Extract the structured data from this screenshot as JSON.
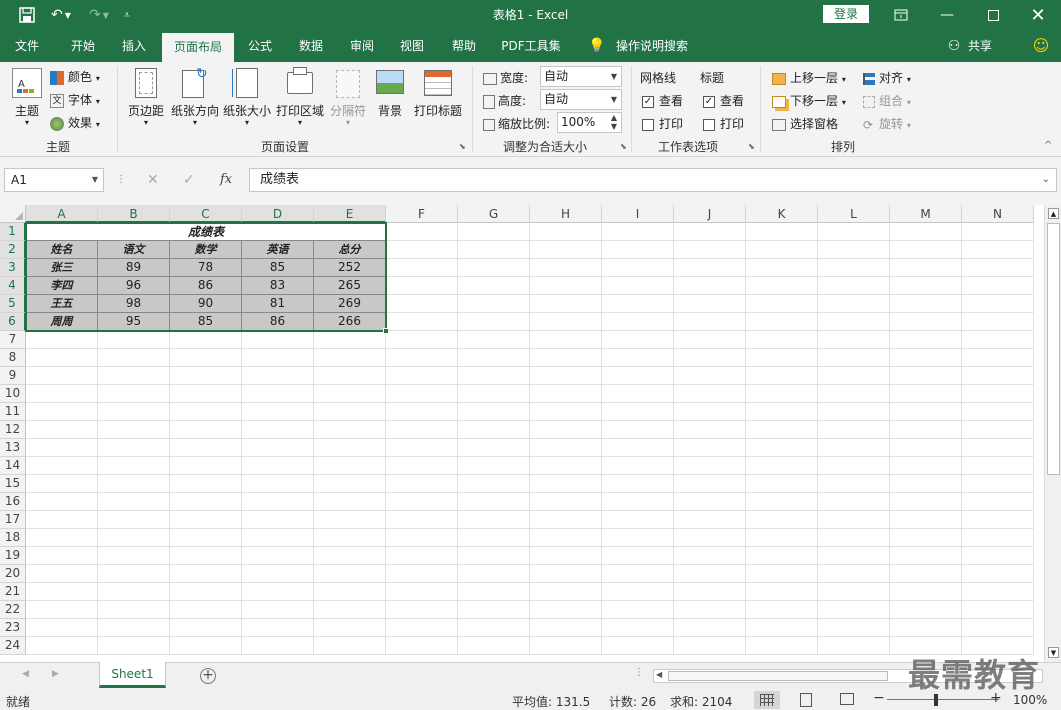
{
  "window": {
    "title": "表格1  -  Excel",
    "login": "登录"
  },
  "tabs": [
    "文件",
    "开始",
    "插入",
    "页面布局",
    "公式",
    "数据",
    "审阅",
    "视图",
    "帮助",
    "PDF工具集",
    "操作说明搜索"
  ],
  "share": "共享",
  "ribbon": {
    "theme": {
      "themes": "主题",
      "colors": "颜色",
      "fonts": "字体",
      "effects": "效果",
      "group": "主题"
    },
    "page_setup": {
      "margins": "页边距",
      "orientation": "纸张方向",
      "size": "纸张大小",
      "print_area": "打印区域",
      "breaks": "分隔符",
      "background": "背景",
      "print_titles": "打印标题",
      "group": "页面设置"
    },
    "scale": {
      "width_label": "宽度:",
      "width_value": "自动",
      "height_label": "高度:",
      "height_value": "自动",
      "scale_label": "缩放比例:",
      "scale_value": "100%",
      "group": "调整为合适大小"
    },
    "sheet_options": {
      "gridlines": "网格线",
      "headings": "标题",
      "view": "查看",
      "print": "打印",
      "group": "工作表选项"
    },
    "arrange": {
      "bring_forward": "上移一层",
      "send_backward": "下移一层",
      "selection_pane": "选择窗格",
      "align": "对齐",
      "group_btn": "组合",
      "rotate": "旋转",
      "group": "排列"
    }
  },
  "formula_bar": {
    "name_box": "A1",
    "fx": "fx",
    "content": "成绩表"
  },
  "columns": [
    "A",
    "B",
    "C",
    "D",
    "E",
    "F",
    "G",
    "H",
    "I",
    "J",
    "K",
    "L",
    "M",
    "N"
  ],
  "rows": [
    "1",
    "2",
    "3",
    "4",
    "5",
    "6",
    "7",
    "8",
    "9",
    "10",
    "11",
    "12",
    "13",
    "14",
    "15",
    "16",
    "17",
    "18",
    "19",
    "20",
    "21",
    "22",
    "23",
    "24"
  ],
  "table": {
    "title": "成绩表",
    "headers": [
      "姓名",
      "语文",
      "数学",
      "英语",
      "总分"
    ],
    "rows": [
      [
        "张三",
        "89",
        "78",
        "85",
        "252"
      ],
      [
        "李四",
        "96",
        "86",
        "83",
        "265"
      ],
      [
        "王五",
        "98",
        "90",
        "81",
        "269"
      ],
      [
        "周周",
        "95",
        "85",
        "86",
        "266"
      ]
    ]
  },
  "sheet_tab": "Sheet1",
  "status": {
    "ready": "就绪",
    "average": "平均值: 131.5",
    "count": "计数: 26",
    "sum": "求和: 2104",
    "zoom": "100%"
  },
  "watermark": "最需教育"
}
